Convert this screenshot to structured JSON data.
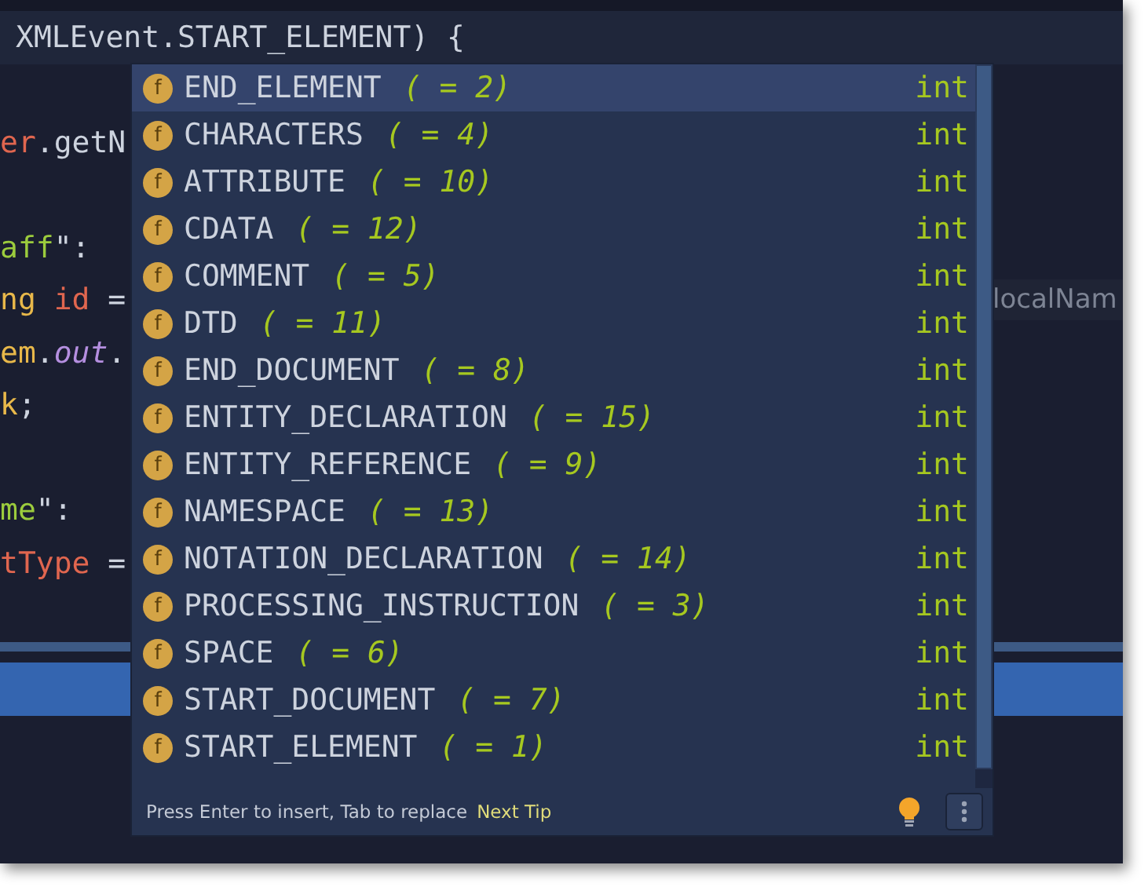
{
  "editor": {
    "lines": [
      {
        "kind": "code",
        "current": true,
        "tokens": [
          {
            "text": "XMLEvent.START_ELEMENT) {",
            "kind": "plain"
          }
        ]
      },
      {
        "kind": "blank"
      },
      {
        "kind": "code",
        "current": false,
        "tokens": [
          {
            "text": "er",
            "kind": "variable"
          },
          {
            "text": ".getN",
            "kind": "plain"
          }
        ]
      },
      {
        "kind": "blank"
      },
      {
        "kind": "code",
        "current": false,
        "tokens": [
          {
            "text": "aff",
            "kind": "string"
          },
          {
            "text": "\":",
            "kind": "plain"
          }
        ]
      },
      {
        "kind": "code",
        "current": false,
        "hint": "localNam",
        "tokens": [
          {
            "text": "ng ",
            "kind": "keyword"
          },
          {
            "text": "id",
            "kind": "variable"
          },
          {
            "text": " =",
            "kind": "plain"
          }
        ]
      },
      {
        "kind": "code",
        "current": false,
        "tokens": [
          {
            "text": "em",
            "kind": "keyword"
          },
          {
            "text": ".",
            "kind": "plain"
          },
          {
            "text": "out",
            "kind": "field"
          },
          {
            "text": ".",
            "kind": "plain"
          }
        ]
      },
      {
        "kind": "code",
        "current": false,
        "tokens": [
          {
            "text": "k",
            "kind": "keyword"
          },
          {
            "text": ";",
            "kind": "plain"
          }
        ]
      },
      {
        "kind": "blank"
      },
      {
        "kind": "code",
        "current": false,
        "tokens": [
          {
            "text": "me",
            "kind": "string"
          },
          {
            "text": "\":",
            "kind": "plain"
          }
        ]
      },
      {
        "kind": "code",
        "current": false,
        "tokens": [
          {
            "text": "tType",
            "kind": "variable"
          },
          {
            "text": " =",
            "kind": "plain"
          }
        ]
      },
      {
        "kind": "blank"
      },
      {
        "kind": "selection"
      }
    ]
  },
  "completion": {
    "items": [
      {
        "icon": "f",
        "name": "END_ELEMENT",
        "value": "( = 2)",
        "type": "int",
        "selected": true
      },
      {
        "icon": "f",
        "name": "CHARACTERS",
        "value": "( = 4)",
        "type": "int",
        "selected": false
      },
      {
        "icon": "f",
        "name": "ATTRIBUTE",
        "value": "( = 10)",
        "type": "int",
        "selected": false
      },
      {
        "icon": "f",
        "name": "CDATA",
        "value": "( = 12)",
        "type": "int",
        "selected": false
      },
      {
        "icon": "f",
        "name": "COMMENT",
        "value": "( = 5)",
        "type": "int",
        "selected": false
      },
      {
        "icon": "f",
        "name": "DTD",
        "value": "( = 11)",
        "type": "int",
        "selected": false
      },
      {
        "icon": "f",
        "name": "END_DOCUMENT",
        "value": "( = 8)",
        "type": "int",
        "selected": false
      },
      {
        "icon": "f",
        "name": "ENTITY_DECLARATION",
        "value": "( = 15)",
        "type": "int",
        "selected": false
      },
      {
        "icon": "f",
        "name": "ENTITY_REFERENCE",
        "value": "( = 9)",
        "type": "int",
        "selected": false
      },
      {
        "icon": "f",
        "name": "NAMESPACE",
        "value": "( = 13)",
        "type": "int",
        "selected": false
      },
      {
        "icon": "f",
        "name": "NOTATION_DECLARATION",
        "value": "( = 14)",
        "type": "int",
        "selected": false
      },
      {
        "icon": "f",
        "name": "PROCESSING_INSTRUCTION",
        "value": "( = 3)",
        "type": "int",
        "selected": false
      },
      {
        "icon": "f",
        "name": "SPACE",
        "value": "( = 6)",
        "type": "int",
        "selected": false
      },
      {
        "icon": "f",
        "name": "START_DOCUMENT",
        "value": "( = 7)",
        "type": "int",
        "selected": false
      },
      {
        "icon": "f",
        "name": "START_ELEMENT",
        "value": "( = 1)",
        "type": "int",
        "selected": false
      }
    ],
    "footer": {
      "hint": "Press Enter to insert, Tab to replace",
      "link": "Next Tip"
    }
  }
}
